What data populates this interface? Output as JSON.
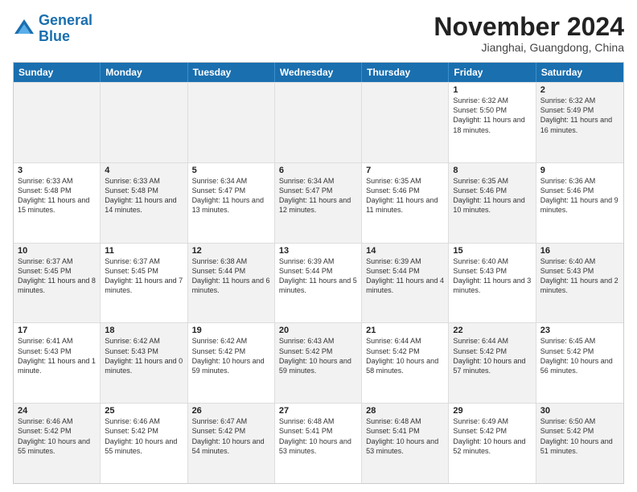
{
  "logo": {
    "line1": "General",
    "line2": "Blue"
  },
  "title": "November 2024",
  "subtitle": "Jianghai, Guangdong, China",
  "header_days": [
    "Sunday",
    "Monday",
    "Tuesday",
    "Wednesday",
    "Thursday",
    "Friday",
    "Saturday"
  ],
  "rows": [
    [
      {
        "day": "",
        "info": "",
        "shaded": true
      },
      {
        "day": "",
        "info": "",
        "shaded": true
      },
      {
        "day": "",
        "info": "",
        "shaded": true
      },
      {
        "day": "",
        "info": "",
        "shaded": true
      },
      {
        "day": "",
        "info": "",
        "shaded": true
      },
      {
        "day": "1",
        "info": "Sunrise: 6:32 AM\nSunset: 5:50 PM\nDaylight: 11 hours and 18 minutes."
      },
      {
        "day": "2",
        "info": "Sunrise: 6:32 AM\nSunset: 5:49 PM\nDaylight: 11 hours and 16 minutes.",
        "shaded": true
      }
    ],
    [
      {
        "day": "3",
        "info": "Sunrise: 6:33 AM\nSunset: 5:48 PM\nDaylight: 11 hours and 15 minutes."
      },
      {
        "day": "4",
        "info": "Sunrise: 6:33 AM\nSunset: 5:48 PM\nDaylight: 11 hours and 14 minutes.",
        "shaded": true
      },
      {
        "day": "5",
        "info": "Sunrise: 6:34 AM\nSunset: 5:47 PM\nDaylight: 11 hours and 13 minutes."
      },
      {
        "day": "6",
        "info": "Sunrise: 6:34 AM\nSunset: 5:47 PM\nDaylight: 11 hours and 12 minutes.",
        "shaded": true
      },
      {
        "day": "7",
        "info": "Sunrise: 6:35 AM\nSunset: 5:46 PM\nDaylight: 11 hours and 11 minutes."
      },
      {
        "day": "8",
        "info": "Sunrise: 6:35 AM\nSunset: 5:46 PM\nDaylight: 11 hours and 10 minutes.",
        "shaded": true
      },
      {
        "day": "9",
        "info": "Sunrise: 6:36 AM\nSunset: 5:46 PM\nDaylight: 11 hours and 9 minutes."
      }
    ],
    [
      {
        "day": "10",
        "info": "Sunrise: 6:37 AM\nSunset: 5:45 PM\nDaylight: 11 hours and 8 minutes.",
        "shaded": true
      },
      {
        "day": "11",
        "info": "Sunrise: 6:37 AM\nSunset: 5:45 PM\nDaylight: 11 hours and 7 minutes."
      },
      {
        "day": "12",
        "info": "Sunrise: 6:38 AM\nSunset: 5:44 PM\nDaylight: 11 hours and 6 minutes.",
        "shaded": true
      },
      {
        "day": "13",
        "info": "Sunrise: 6:39 AM\nSunset: 5:44 PM\nDaylight: 11 hours and 5 minutes."
      },
      {
        "day": "14",
        "info": "Sunrise: 6:39 AM\nSunset: 5:44 PM\nDaylight: 11 hours and 4 minutes.",
        "shaded": true
      },
      {
        "day": "15",
        "info": "Sunrise: 6:40 AM\nSunset: 5:43 PM\nDaylight: 11 hours and 3 minutes."
      },
      {
        "day": "16",
        "info": "Sunrise: 6:40 AM\nSunset: 5:43 PM\nDaylight: 11 hours and 2 minutes.",
        "shaded": true
      }
    ],
    [
      {
        "day": "17",
        "info": "Sunrise: 6:41 AM\nSunset: 5:43 PM\nDaylight: 11 hours and 1 minute."
      },
      {
        "day": "18",
        "info": "Sunrise: 6:42 AM\nSunset: 5:43 PM\nDaylight: 11 hours and 0 minutes.",
        "shaded": true
      },
      {
        "day": "19",
        "info": "Sunrise: 6:42 AM\nSunset: 5:42 PM\nDaylight: 10 hours and 59 minutes."
      },
      {
        "day": "20",
        "info": "Sunrise: 6:43 AM\nSunset: 5:42 PM\nDaylight: 10 hours and 59 minutes.",
        "shaded": true
      },
      {
        "day": "21",
        "info": "Sunrise: 6:44 AM\nSunset: 5:42 PM\nDaylight: 10 hours and 58 minutes."
      },
      {
        "day": "22",
        "info": "Sunrise: 6:44 AM\nSunset: 5:42 PM\nDaylight: 10 hours and 57 minutes.",
        "shaded": true
      },
      {
        "day": "23",
        "info": "Sunrise: 6:45 AM\nSunset: 5:42 PM\nDaylight: 10 hours and 56 minutes."
      }
    ],
    [
      {
        "day": "24",
        "info": "Sunrise: 6:46 AM\nSunset: 5:42 PM\nDaylight: 10 hours and 55 minutes.",
        "shaded": true
      },
      {
        "day": "25",
        "info": "Sunrise: 6:46 AM\nSunset: 5:42 PM\nDaylight: 10 hours and 55 minutes."
      },
      {
        "day": "26",
        "info": "Sunrise: 6:47 AM\nSunset: 5:42 PM\nDaylight: 10 hours and 54 minutes.",
        "shaded": true
      },
      {
        "day": "27",
        "info": "Sunrise: 6:48 AM\nSunset: 5:41 PM\nDaylight: 10 hours and 53 minutes."
      },
      {
        "day": "28",
        "info": "Sunrise: 6:48 AM\nSunset: 5:41 PM\nDaylight: 10 hours and 53 minutes.",
        "shaded": true
      },
      {
        "day": "29",
        "info": "Sunrise: 6:49 AM\nSunset: 5:42 PM\nDaylight: 10 hours and 52 minutes."
      },
      {
        "day": "30",
        "info": "Sunrise: 6:50 AM\nSunset: 5:42 PM\nDaylight: 10 hours and 51 minutes.",
        "shaded": true
      }
    ]
  ]
}
